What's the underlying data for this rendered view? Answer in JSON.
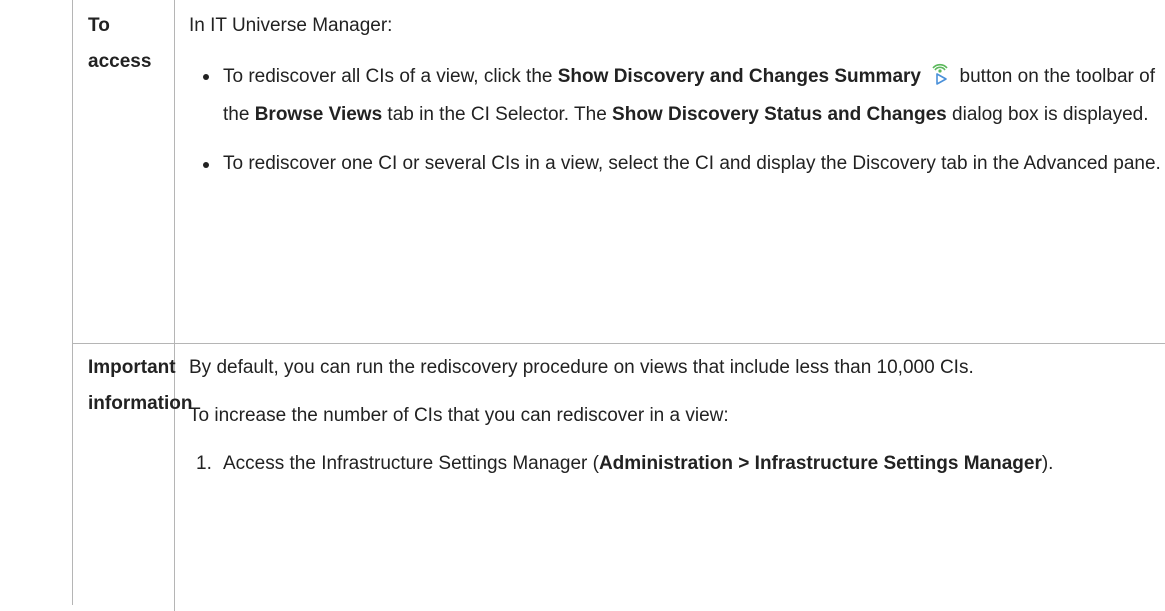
{
  "row1": {
    "label": "To access",
    "intro": "In IT Universe Manager:",
    "bullet1": {
      "t1": "To rediscover all CIs of a view, click the ",
      "b1": "Show Discovery and Changes Summary",
      "t2": " button on the toolbar of the ",
      "b2": "Browse Views",
      "t3": " tab in the CI Selector. The ",
      "b3": "Show Discovery Status and Changes",
      "t4": " dialog box is displayed."
    },
    "bullet2": "To rediscover one CI or several CIs in a view, select the CI and display the Discovery tab in the Advanced pane."
  },
  "row2": {
    "label_line1": "Important",
    "label_line2": "information",
    "p1": "By default, you can run the rediscovery procedure on views that include less than 10,000 CIs.",
    "p2": "To increase the number of CIs that you can rediscover in a view:",
    "step1": {
      "num": "1.",
      "t1": "Access the Infrastructure Settings Manager (",
      "b1": "Administration > Infrastructure Settings Manager",
      "t2": ")."
    }
  },
  "icons": {
    "discovery": "discovery-changes-icon"
  }
}
